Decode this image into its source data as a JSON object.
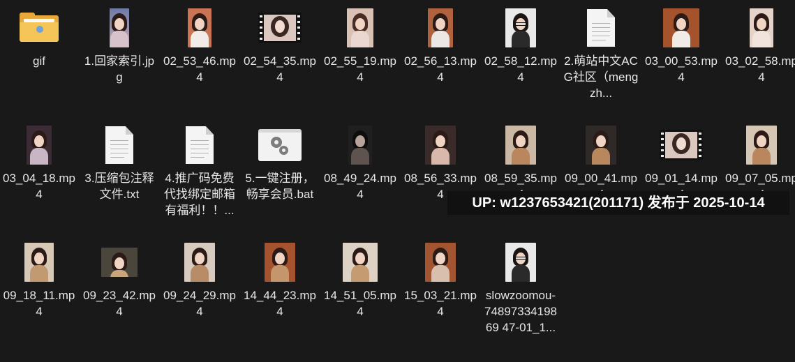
{
  "items": [
    {
      "label": "gif",
      "icon": "folder-icon"
    },
    {
      "label": "1.回家索引.jpg",
      "icon": "image-thumbnail-icon"
    },
    {
      "label": "02_53_46.mp4",
      "icon": "video-thumbnail-icon"
    },
    {
      "label": "02_54_35.mp4",
      "icon": "video-filmstrip-icon"
    },
    {
      "label": "02_55_19.mp4",
      "icon": "video-thumbnail-icon"
    },
    {
      "label": "02_56_13.mp4",
      "icon": "video-thumbnail-icon"
    },
    {
      "label": "02_58_12.mp4",
      "icon": "video-thumbnail-icon"
    },
    {
      "label": "2.萌站中文ACG社区（mengzh...",
      "icon": "document-icon"
    },
    {
      "label": "03_00_53.mp4",
      "icon": "video-thumbnail-icon"
    },
    {
      "label": "03_02_58.mp4",
      "icon": "video-thumbnail-icon"
    },
    {
      "label": "03_04_18.mp4",
      "icon": "video-thumbnail-icon"
    },
    {
      "label": "3.压缩包注释文件.txt",
      "icon": "text-document-icon"
    },
    {
      "label": "4.推广码免费代找绑定邮箱有福利！！...",
      "icon": "document-icon"
    },
    {
      "label": "5.一键注册，畅享会员.bat",
      "icon": "gears-icon"
    },
    {
      "label": "08_49_24.mp4",
      "icon": "video-thumbnail-icon"
    },
    {
      "label": "08_56_33.mp4",
      "icon": "video-thumbnail-icon"
    },
    {
      "label": "08_59_35.mp4",
      "icon": "video-thumbnail-icon"
    },
    {
      "label": "09_00_41.mp4",
      "icon": "video-thumbnail-icon"
    },
    {
      "label": "09_01_14.mp4",
      "icon": "video-filmstrip-icon"
    },
    {
      "label": "09_07_05.mp4",
      "icon": "video-thumbnail-icon"
    },
    {
      "label": "09_18_11.mp4",
      "icon": "video-thumbnail-icon"
    },
    {
      "label": "09_23_42.mp4",
      "icon": "video-thumbnail-icon"
    },
    {
      "label": "09_24_29.mp4",
      "icon": "video-thumbnail-icon"
    },
    {
      "label": "14_44_23.mp4",
      "icon": "video-thumbnail-icon"
    },
    {
      "label": "14_51_05.mp4",
      "icon": "video-thumbnail-icon"
    },
    {
      "label": "15_03_21.mp4",
      "icon": "video-thumbnail-icon"
    },
    {
      "label": "slowzoomou-7489733419869 47-01_1...",
      "icon": "video-thumbnail-icon"
    }
  ],
  "overlay": {
    "text": "UP: w1237653421(201171) 发布于 2025-10-14"
  }
}
